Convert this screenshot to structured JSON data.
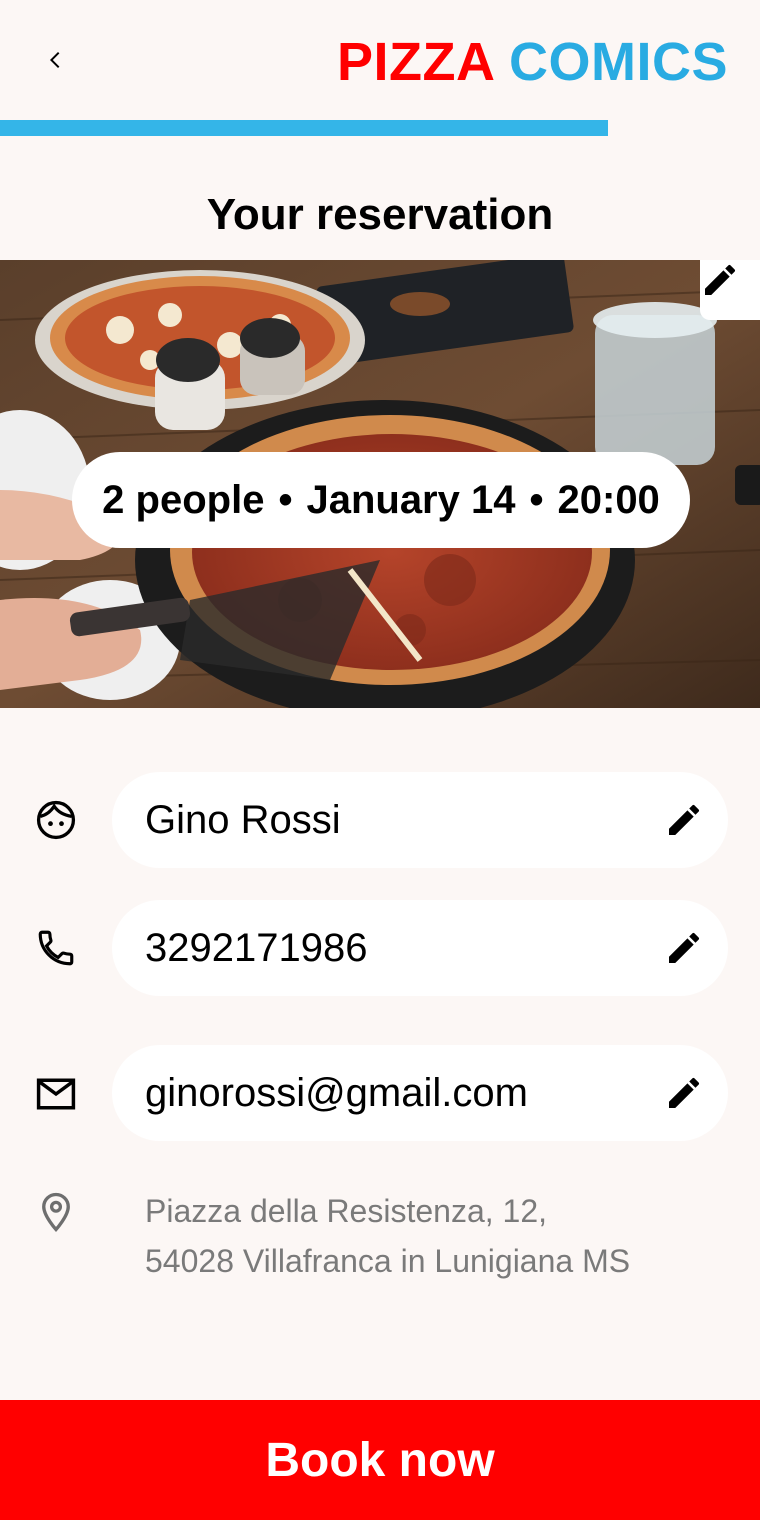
{
  "header": {
    "brand_word1": "PIZZA",
    "brand_word2": "COMICS",
    "back_icon": "chevron-left-icon",
    "progress_fraction": 0.8
  },
  "page": {
    "title": "Your reservation"
  },
  "reservation": {
    "people": "2 people",
    "date": "January 14",
    "time": "20:00",
    "separator": "•",
    "edit_icon": "pencil-icon"
  },
  "form": {
    "name": {
      "value": "Gino Rossi",
      "icon": "face-icon",
      "edit_icon": "pencil-icon"
    },
    "phone": {
      "value": "3292171986",
      "icon": "phone-icon",
      "edit_icon": "pencil-icon"
    },
    "email": {
      "value": "ginorossi@gmail.com",
      "icon": "mail-icon",
      "edit_icon": "pencil-icon"
    },
    "address": {
      "line1": "Piazza della Resistenza, 12,",
      "line2": "54028 Villafranca in Lunigiana MS",
      "icon": "location-pin-icon"
    }
  },
  "actions": {
    "book_label": "Book now"
  },
  "colors": {
    "brand_red": "#ff0000",
    "brand_blue": "#29abe2",
    "progress": "#34b5e8",
    "background": "#fcf7f5",
    "button": "#ff0000"
  }
}
